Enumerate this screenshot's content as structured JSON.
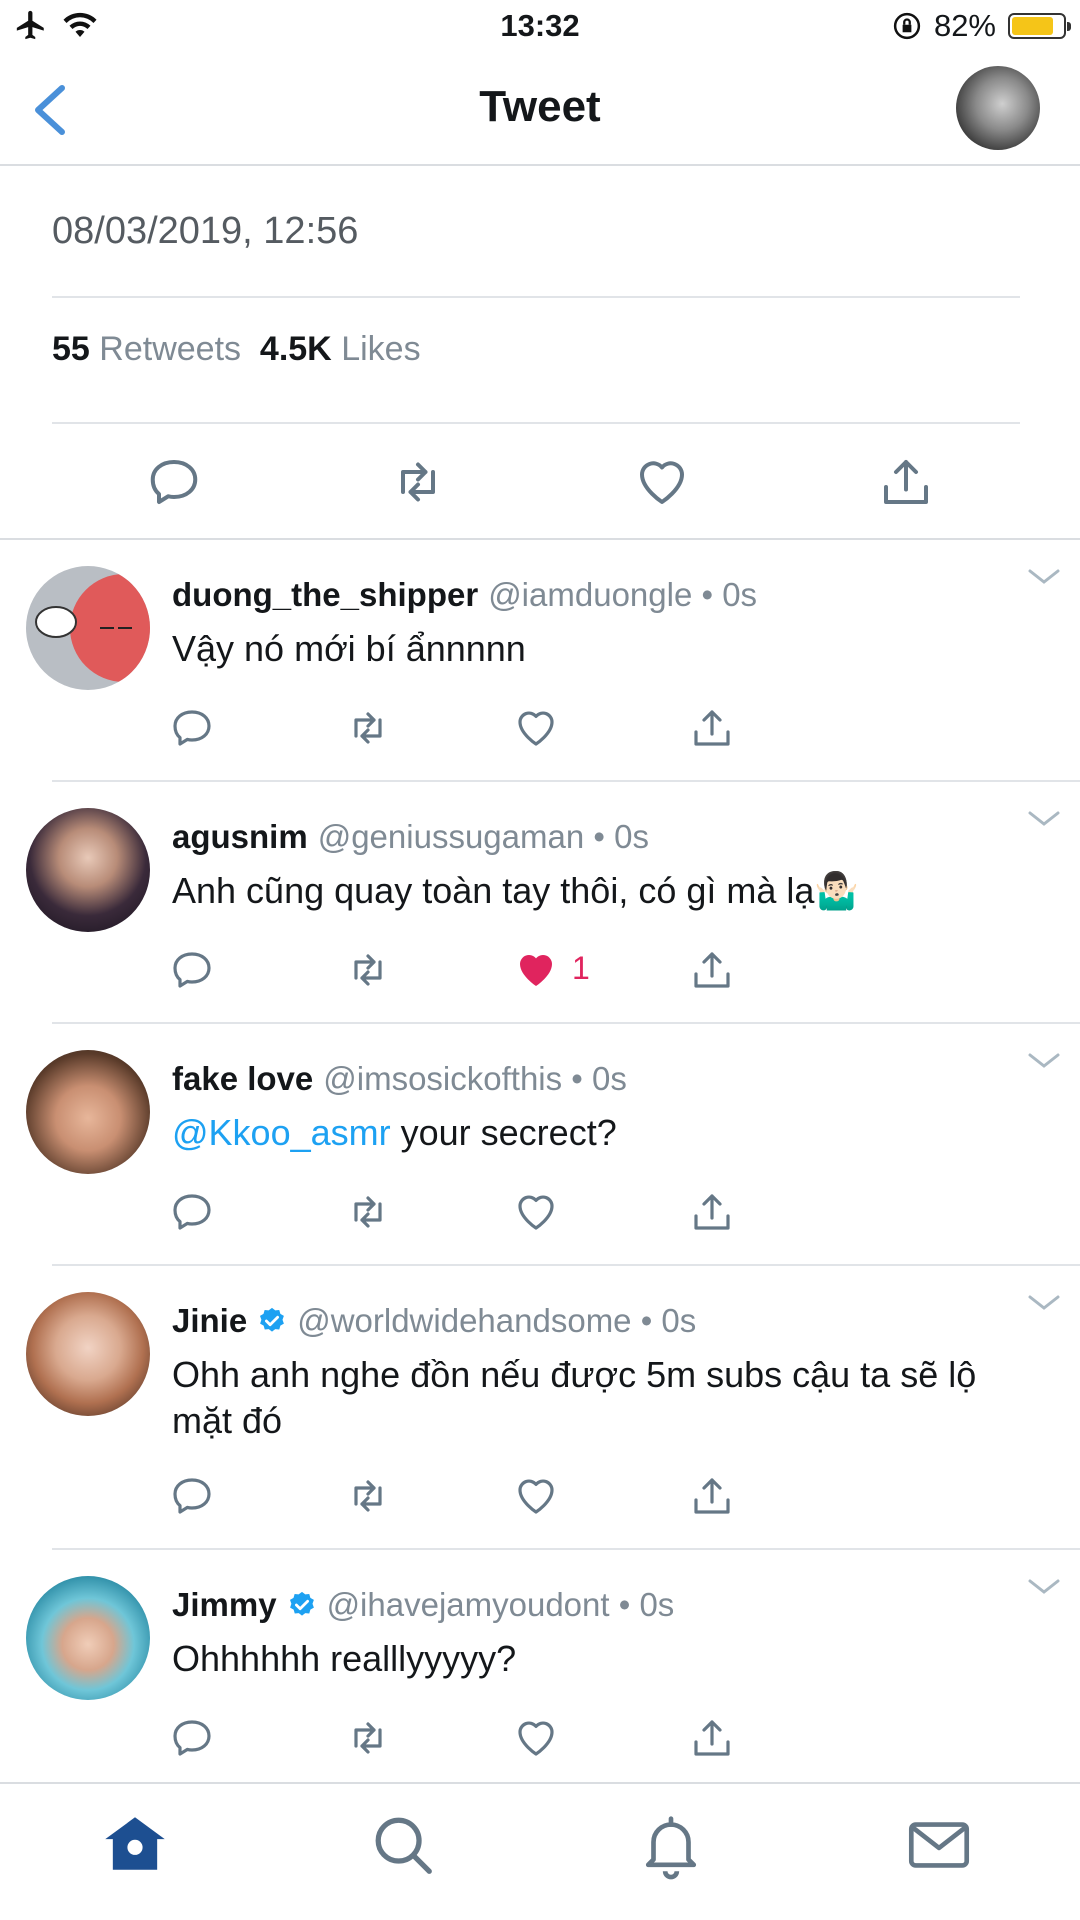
{
  "status_bar": {
    "time": "13:32",
    "battery_percent": "82%",
    "battery_level": 0.82,
    "icons": [
      "airplane-icon",
      "wifi-icon",
      "orientation-lock-icon",
      "battery-icon"
    ]
  },
  "nav": {
    "title": "Tweet",
    "back_icon": "chevron-left-icon",
    "avatar": "profile-avatar"
  },
  "tweet": {
    "timestamp": "08/03/2019, 12:56",
    "retweets_count": "55",
    "retweets_label": "Retweets",
    "likes_count": "4.5K",
    "likes_label": "Likes",
    "actions": [
      "reply-icon",
      "retweet-icon",
      "like-icon",
      "share-icon"
    ]
  },
  "replies": [
    {
      "name": "duong_the_shipper",
      "handle": "@iamduongle • 0s",
      "text": "Vậy nó mới bí ẩnnnnn",
      "verified": false,
      "liked": false,
      "like_count": ""
    },
    {
      "name": "agusnim",
      "handle": "@geniussugaman • 0s",
      "text": "Anh cũng quay toàn tay thôi, có gì mà lạ🤷🏻‍♂️",
      "verified": false,
      "liked": true,
      "like_count": "1"
    },
    {
      "name": "fake love",
      "handle": "@imsosickofthis • 0s",
      "mention": "@Kkoo_asmr",
      "text": " your secrect?",
      "verified": false,
      "liked": false,
      "like_count": ""
    },
    {
      "name": "Jinie",
      "handle": "@worldwidehandsome • 0s",
      "text": "Ohh anh nghe đồn nếu được 5m subs cậu ta sẽ lộ mặt đó",
      "verified": true,
      "liked": false,
      "like_count": ""
    },
    {
      "name": "Jimmy",
      "handle": "@ihavejamyoudont • 0s",
      "text": "Ohhhhhh realllyyyyy?",
      "verified": true,
      "liked": false,
      "like_count": ""
    }
  ],
  "tab_bar": [
    "home-icon",
    "search-icon",
    "notifications-icon",
    "messages-icon"
  ],
  "colors": {
    "accent": "#1da1f2",
    "like": "#e0245e",
    "muted": "#7f8a94",
    "tab_active": "#1d4f91",
    "battery": "#f5c518"
  }
}
